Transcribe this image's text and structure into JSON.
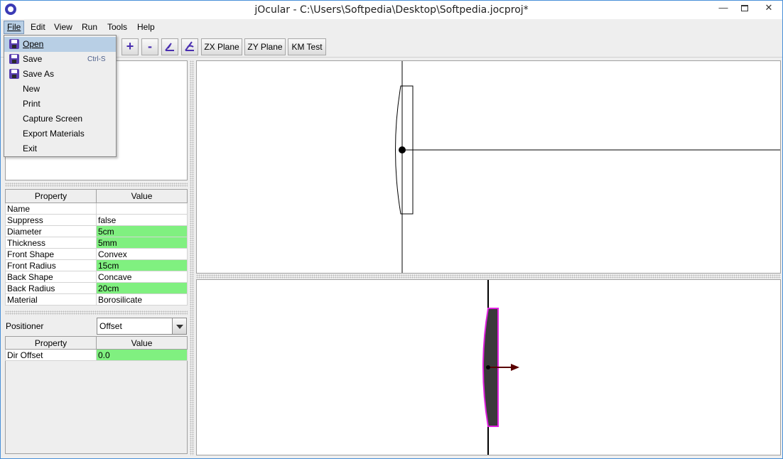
{
  "window": {
    "title": "jOcular - C:\\Users\\Softpedia\\Desktop\\Softpedia.jocproj*"
  },
  "menubar": {
    "items": [
      "File",
      "Edit",
      "View",
      "Run",
      "Tools",
      "Help"
    ]
  },
  "toolbar": {
    "icons": [
      "+",
      "-"
    ],
    "zx_plane": "ZX Plane",
    "zy_plane": "ZY Plane",
    "km_test": "KM Test"
  },
  "file_menu": {
    "items": [
      {
        "label": "Open",
        "shortcut": "",
        "icon": "save-disk-icon"
      },
      {
        "label": "Save",
        "shortcut": "Ctrl-S",
        "icon": "save-disk-icon"
      },
      {
        "label": "Save As",
        "shortcut": "",
        "icon": "save-disk-icon"
      },
      {
        "label": "New",
        "shortcut": ""
      },
      {
        "label": "Print",
        "shortcut": ""
      },
      {
        "label": "Capture Screen",
        "shortcut": ""
      },
      {
        "label": "Export Materials",
        "shortcut": ""
      },
      {
        "label": "Exit",
        "shortcut": ""
      }
    ]
  },
  "properties": {
    "headers": [
      "Property",
      "Value"
    ],
    "rows": [
      {
        "property": "Name",
        "value": "",
        "highlight": false
      },
      {
        "property": "Suppress",
        "value": "false",
        "highlight": false
      },
      {
        "property": "Diameter",
        "value": "5cm",
        "highlight": true
      },
      {
        "property": "Thickness",
        "value": "5mm",
        "highlight": true
      },
      {
        "property": "Front Shape",
        "value": "Convex",
        "highlight": false
      },
      {
        "property": "Front Radius",
        "value": "15cm",
        "highlight": true
      },
      {
        "property": "Back Shape",
        "value": "Concave",
        "highlight": false
      },
      {
        "property": "Back Radius",
        "value": "20cm",
        "highlight": true
      },
      {
        "property": "Material",
        "value": "Borosilicate",
        "highlight": false
      }
    ]
  },
  "positioner": {
    "label": "Positioner",
    "selected": "Offset",
    "headers": [
      "Property",
      "Value"
    ],
    "rows": [
      {
        "property": "Dir Offset",
        "value": "0.0"
      }
    ]
  },
  "colors": {
    "highlight_green": "#80f080",
    "menu_highlight": "#b8cfe5",
    "lens_edge_magenta": "#e020e0",
    "arrow_darkred": "#5a0000"
  }
}
